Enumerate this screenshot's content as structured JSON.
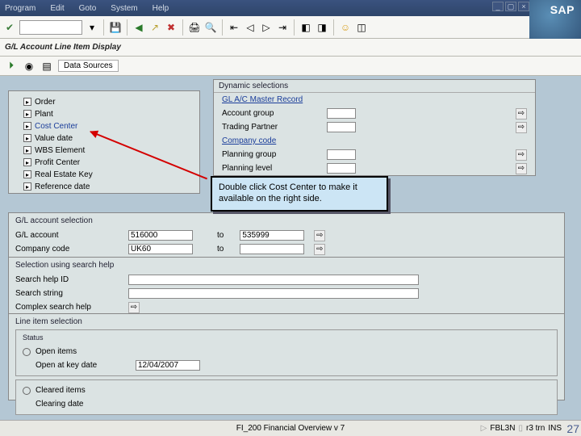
{
  "menu": [
    "Program",
    "Edit",
    "Goto",
    "System",
    "Help"
  ],
  "logo": "SAP",
  "page_title": "G/L Account Line Item Display",
  "toolbar2_btn": "Data Sources",
  "left_tree": [
    "Order",
    "Plant",
    "Cost Center",
    "Value date",
    "WBS Element",
    "Profit Center",
    "Real Estate Key",
    "Reference date"
  ],
  "right_panel": {
    "title": "Dynamic selections",
    "link1": "GL A/C Master Record",
    "rows": [
      {
        "label": "Account group",
        "link": false
      },
      {
        "label": "Trading Partner",
        "link": false
      },
      {
        "label": "Company code",
        "link": true
      },
      {
        "label": "Planning group",
        "link": false
      },
      {
        "label": "Planning level",
        "link": false
      }
    ]
  },
  "callout_text": "Double click Cost Center to make it available on the right side.",
  "gl_selection": {
    "legend": "G/L account selection",
    "rows": [
      {
        "label": "G/L account",
        "val1": "516000",
        "to": "to",
        "val2": "535999"
      },
      {
        "label": "Company code",
        "val1": "UK60",
        "to": "to",
        "val2": ""
      }
    ]
  },
  "search_help": {
    "legend": "Selection using search help",
    "rows": [
      "Search help ID",
      "Search string",
      "Complex search help"
    ]
  },
  "line_item": {
    "legend": "Line item selection",
    "status": "Status",
    "open_items": "Open items",
    "open_date_label": "Open at key date",
    "open_date_val": "12/04/2007",
    "cleared": "Cleared items",
    "clearing_date": "Clearing date"
  },
  "footer": {
    "center": "FI_200 Financial Overview v 7",
    "tcode": "FBL3N",
    "client": "r3 trn",
    "server": "INS"
  },
  "slide_num": "27"
}
